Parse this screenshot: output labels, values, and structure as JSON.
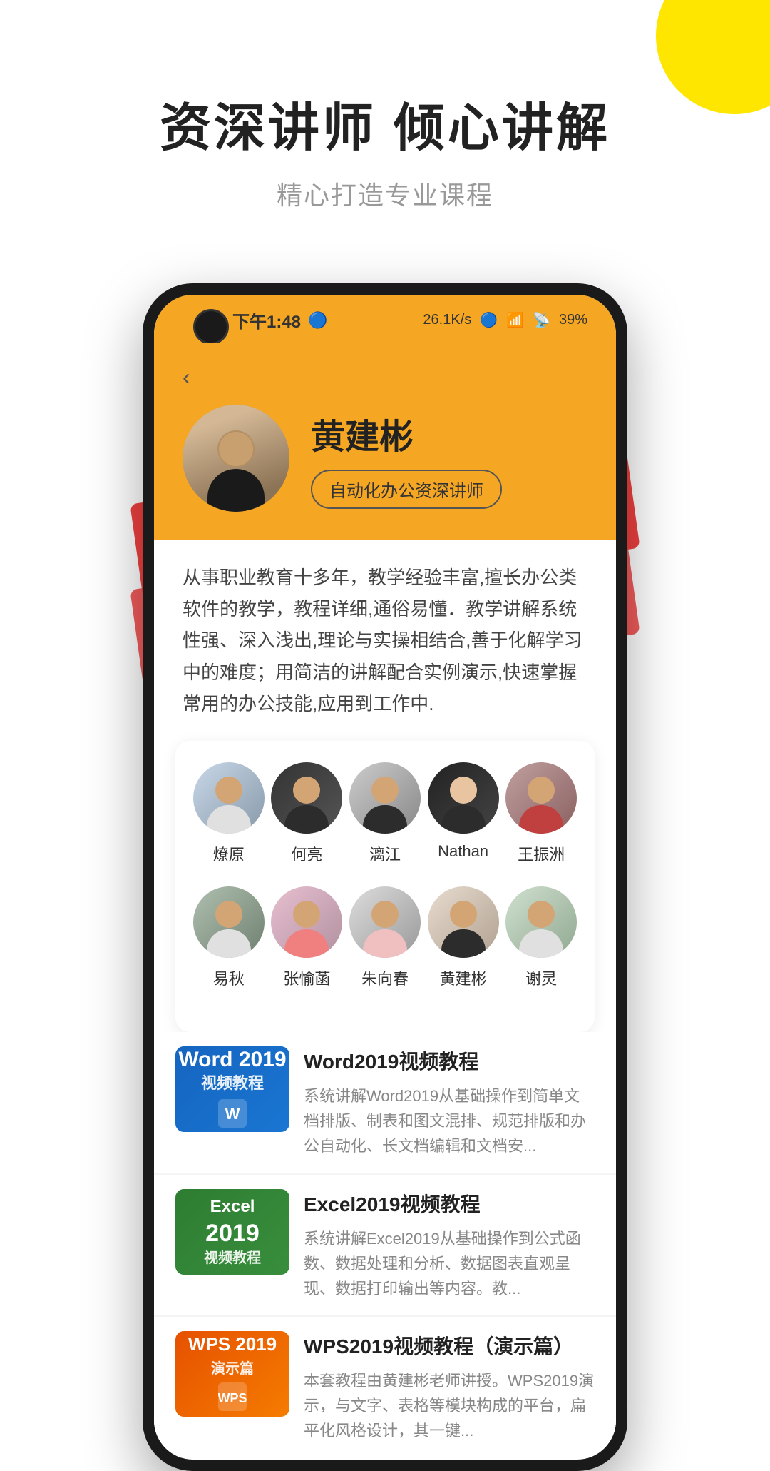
{
  "hero": {
    "title": "资深讲师  倾心讲解",
    "subtitle": "精心打造专业课程"
  },
  "statusBar": {
    "time": "下午1:48",
    "speed": "26.1K/s",
    "battery": "39%",
    "indicator": "🔵"
  },
  "teacher": {
    "name": "黄建彬",
    "badge": "自动化办公资深讲师",
    "description": "从事职业教育十多年，教学经验丰富,擅长办公类软件的教学，教程详细,通俗易懂．教学讲解系统性强、深入浅出,理论与实操相结合,善于化解学习中的难度；用简洁的讲解配合实例演示,快速掌握常用的办公技能,应用到工作中.",
    "backLabel": "‹"
  },
  "instructors": {
    "row1": [
      {
        "name": "燎原",
        "avatarClass": "av-1"
      },
      {
        "name": "何亮",
        "avatarClass": "av-2"
      },
      {
        "name": "漓江",
        "avatarClass": "av-3"
      },
      {
        "name": "Nathan",
        "avatarClass": "av-4"
      },
      {
        "name": "王振洲",
        "avatarClass": "av-5"
      }
    ],
    "row2": [
      {
        "name": "易秋",
        "avatarClass": "av-6"
      },
      {
        "name": "张愉菡",
        "avatarClass": "av-7"
      },
      {
        "name": "朱向春",
        "avatarClass": "av-8"
      },
      {
        "name": "黄建彬",
        "avatarClass": "av-9"
      },
      {
        "name": "谢灵",
        "avatarClass": "av-10"
      }
    ]
  },
  "courses": [
    {
      "title": "Word2019视频教程",
      "description": "系统讲解Word2019从基础操作到简单文档排版、制表和图文混排、规范排版和办公自动化、长文档编辑和文档安...",
      "thumbLabel": "Word 2019\n视频教程",
      "thumbClass": "course-thumb-word"
    },
    {
      "title": "Excel2019视频教程",
      "description": "系统讲解Excel2019从基础操作到公式函数、数据处理和分析、数据图表直观呈现、数据打印输出等内容。教...",
      "thumbLabel": "Excel\n2019\n视频教程",
      "thumbClass": "course-thumb-excel"
    },
    {
      "title": "WPS2019视频教程（演示篇）",
      "description": "本套教程由黄建彬老师讲授。WPS2019演示，与文字、表格等模块构成的平台，扁平化风格设计，其一键...",
      "thumbLabel": "WPS 2019\n演示篇",
      "thumbClass": "course-thumb-wps"
    }
  ]
}
